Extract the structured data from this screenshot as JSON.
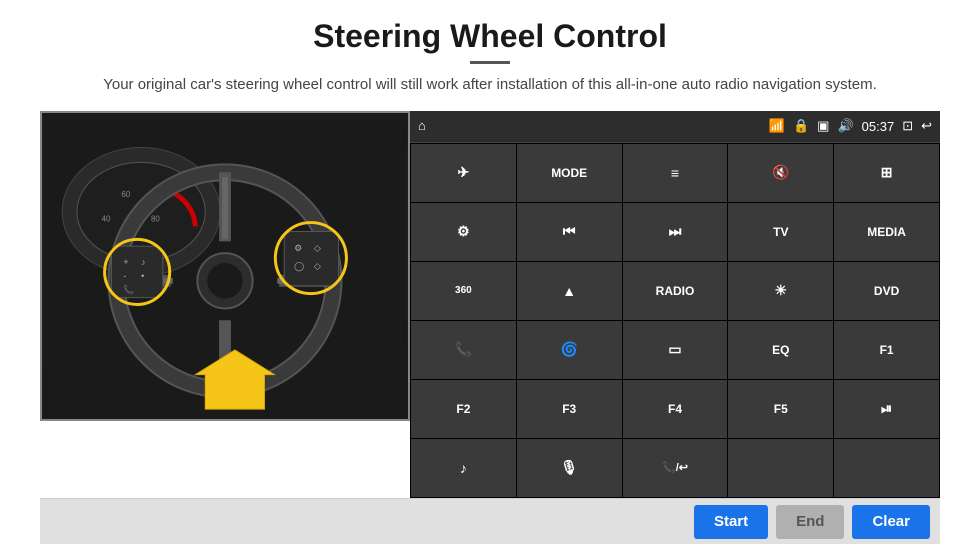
{
  "page": {
    "title": "Steering Wheel Control",
    "subtitle": "Your original car's steering wheel control will still work after installation of this all-in-one auto radio navigation system.",
    "divider": true
  },
  "topbar": {
    "wifi_icon": "📶",
    "lock_icon": "🔒",
    "sd_icon": "💾",
    "bt_icon": "🔊",
    "time": "05:37",
    "window_icon": "⊡",
    "back_icon": "↩"
  },
  "grid_buttons": [
    {
      "id": "r1c1",
      "icon": "⌂",
      "label": ""
    },
    {
      "id": "r1c2",
      "icon": "✈",
      "label": ""
    },
    {
      "id": "r1c3",
      "icon": "MODE",
      "label": "MODE"
    },
    {
      "id": "r1c4",
      "icon": "≡",
      "label": ""
    },
    {
      "id": "r1c5",
      "icon": "🔇",
      "label": ""
    },
    {
      "id": "r1c6",
      "icon": "⊞",
      "label": ""
    },
    {
      "id": "r2c1",
      "icon": "⚙",
      "label": ""
    },
    {
      "id": "r2c2",
      "icon": "⏮",
      "label": ""
    },
    {
      "id": "r2c3",
      "icon": "⏭",
      "label": ""
    },
    {
      "id": "r2c4",
      "icon": "TV",
      "label": "TV"
    },
    {
      "id": "r2c5",
      "icon": "MEDIA",
      "label": "MEDIA"
    },
    {
      "id": "r3c1",
      "icon": "360",
      "label": "360"
    },
    {
      "id": "r3c2",
      "icon": "▲",
      "label": ""
    },
    {
      "id": "r3c3",
      "icon": "RADIO",
      "label": "RADIO"
    },
    {
      "id": "r3c4",
      "icon": "☀",
      "label": ""
    },
    {
      "id": "r3c5",
      "icon": "DVD",
      "label": "DVD"
    },
    {
      "id": "r4c1",
      "icon": "📞",
      "label": ""
    },
    {
      "id": "r4c2",
      "icon": "🌀",
      "label": ""
    },
    {
      "id": "r4c3",
      "icon": "▭",
      "label": ""
    },
    {
      "id": "r4c4",
      "icon": "EQ",
      "label": "EQ"
    },
    {
      "id": "r4c5",
      "icon": "F1",
      "label": "F1"
    },
    {
      "id": "r5c1",
      "icon": "F2",
      "label": "F2"
    },
    {
      "id": "r5c2",
      "icon": "F3",
      "label": "F3"
    },
    {
      "id": "r5c3",
      "icon": "F4",
      "label": "F4"
    },
    {
      "id": "r5c4",
      "icon": "F5",
      "label": "F5"
    },
    {
      "id": "r5c5",
      "icon": "⏯",
      "label": ""
    },
    {
      "id": "r6c1",
      "icon": "♪",
      "label": ""
    },
    {
      "id": "r6c2",
      "icon": "🎤",
      "label": ""
    },
    {
      "id": "r6c3",
      "icon": "📞/↩",
      "label": ""
    },
    {
      "id": "r6c4",
      "icon": "",
      "label": ""
    },
    {
      "id": "r6c5",
      "icon": "",
      "label": ""
    }
  ],
  "bottom_buttons": {
    "start_label": "Start",
    "end_label": "End",
    "clear_label": "Clear"
  }
}
